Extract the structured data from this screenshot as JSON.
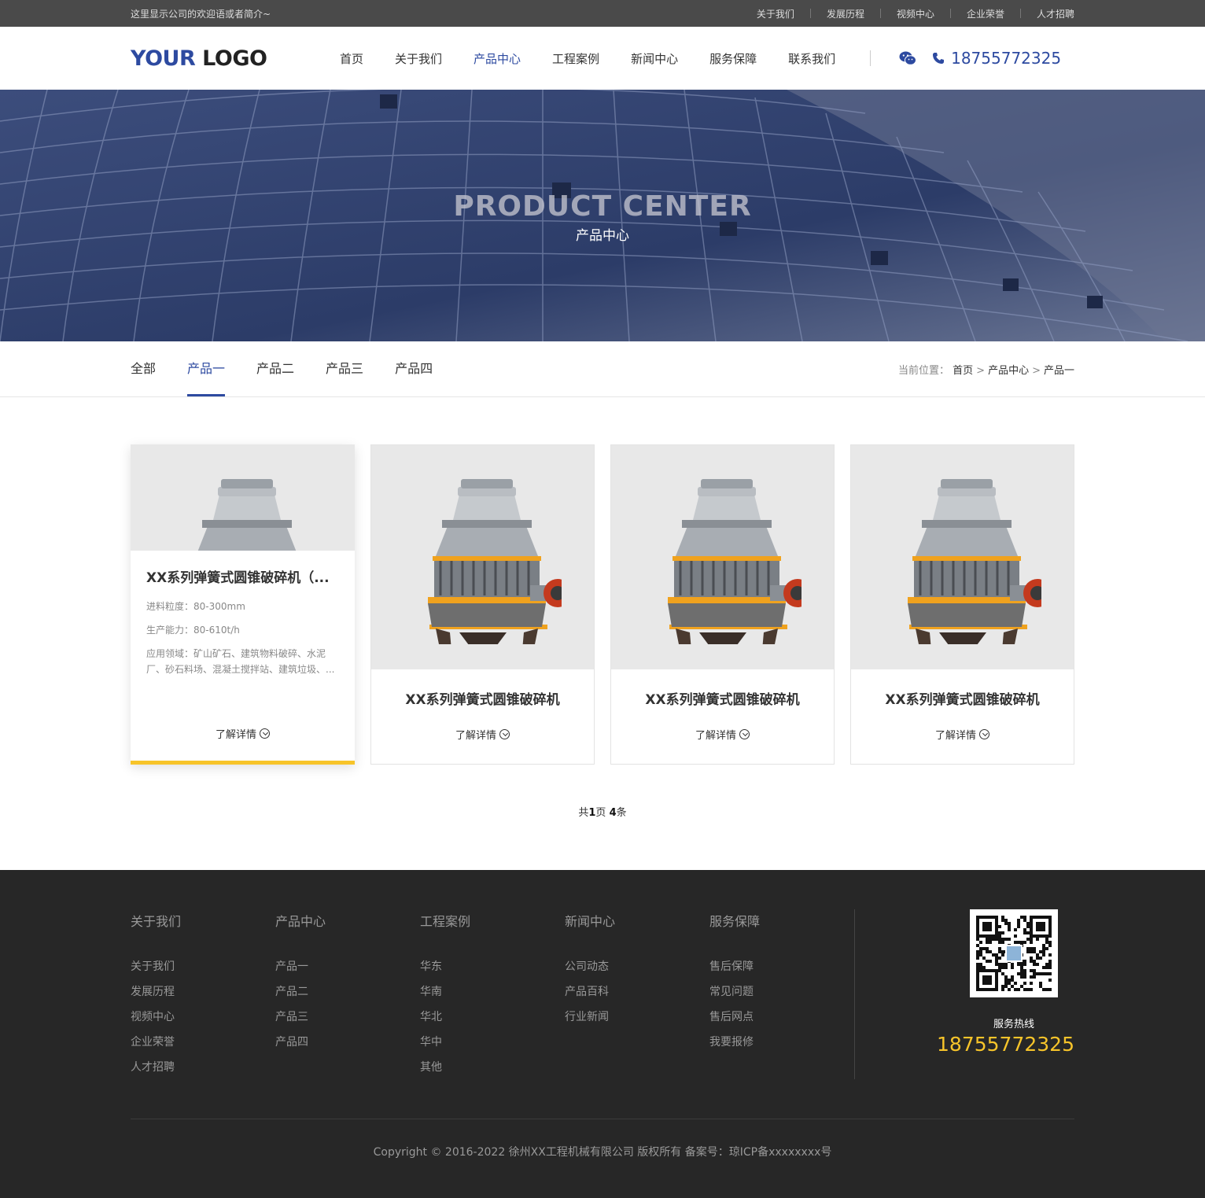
{
  "topbar": {
    "welcome": "这里显示公司的欢迎语或者简介~",
    "links": [
      "关于我们",
      "发展历程",
      "视频中心",
      "企业荣誉",
      "人才招聘"
    ]
  },
  "header": {
    "logo_part1": "YOUR",
    "logo_part2": "LOGO",
    "nav": [
      "首页",
      "关于我们",
      "产品中心",
      "工程案例",
      "新闻中心",
      "服务保障",
      "联系我们"
    ],
    "active_nav": "产品中心",
    "phone": "18755772325"
  },
  "banner": {
    "title": "PRODUCT CENTER",
    "subtitle": "产品中心"
  },
  "categories": {
    "items": [
      "全部",
      "产品一",
      "产品二",
      "产品三",
      "产品四"
    ],
    "active": "产品一"
  },
  "breadcrumb": {
    "label": "当前位置：",
    "items": [
      "首页",
      "产品中心",
      "产品一"
    ]
  },
  "products": {
    "hover_card": {
      "name": "XX系列弹簧式圆锥破碎机（...",
      "spec1": "进料粒度：80-300mm",
      "spec2": "生产能力：80-610t/h",
      "spec3": "应用领域：矿山矿石、建筑物料破碎、水泥厂、砂石料场、混凝土搅拌站、建筑垃圾、...",
      "more": "了解详情"
    },
    "cards": [
      {
        "name": "XX系列弹簧式圆锥破碎机",
        "more": "了解详情"
      },
      {
        "name": "XX系列弹簧式圆锥破碎机",
        "more": "了解详情"
      },
      {
        "name": "XX系列弹簧式圆锥破碎机",
        "more": "了解详情"
      }
    ]
  },
  "pager": {
    "prefix": "共",
    "pages": "1",
    "mid": "页 ",
    "count": "4",
    "suffix": "条"
  },
  "footer": {
    "columns": [
      {
        "title": "关于我们",
        "links": [
          "关于我们",
          "发展历程",
          "视频中心",
          "企业荣誉",
          "人才招聘"
        ]
      },
      {
        "title": "产品中心",
        "links": [
          "产品一",
          "产品二",
          "产品三",
          "产品四"
        ]
      },
      {
        "title": "工程案例",
        "links": [
          "华东",
          "华南",
          "华北",
          "华中",
          "其他"
        ]
      },
      {
        "title": "新闻中心",
        "links": [
          "公司动态",
          "产品百科",
          "行业新闻"
        ]
      },
      {
        "title": "服务保障",
        "links": [
          "售后保障",
          "常见问题",
          "售后网点",
          "我要报修"
        ]
      }
    ],
    "hotline_label": "服务热线",
    "hotline": "18755772325",
    "copyright": "Copyright © 2016-2022 徐州XX工程机械有限公司 版权所有 备案号：琼ICP备xxxxxxxx号"
  },
  "colors": {
    "brand": "#2d4aa0",
    "accent": "#f7c42a",
    "footer_bg": "#272727"
  }
}
